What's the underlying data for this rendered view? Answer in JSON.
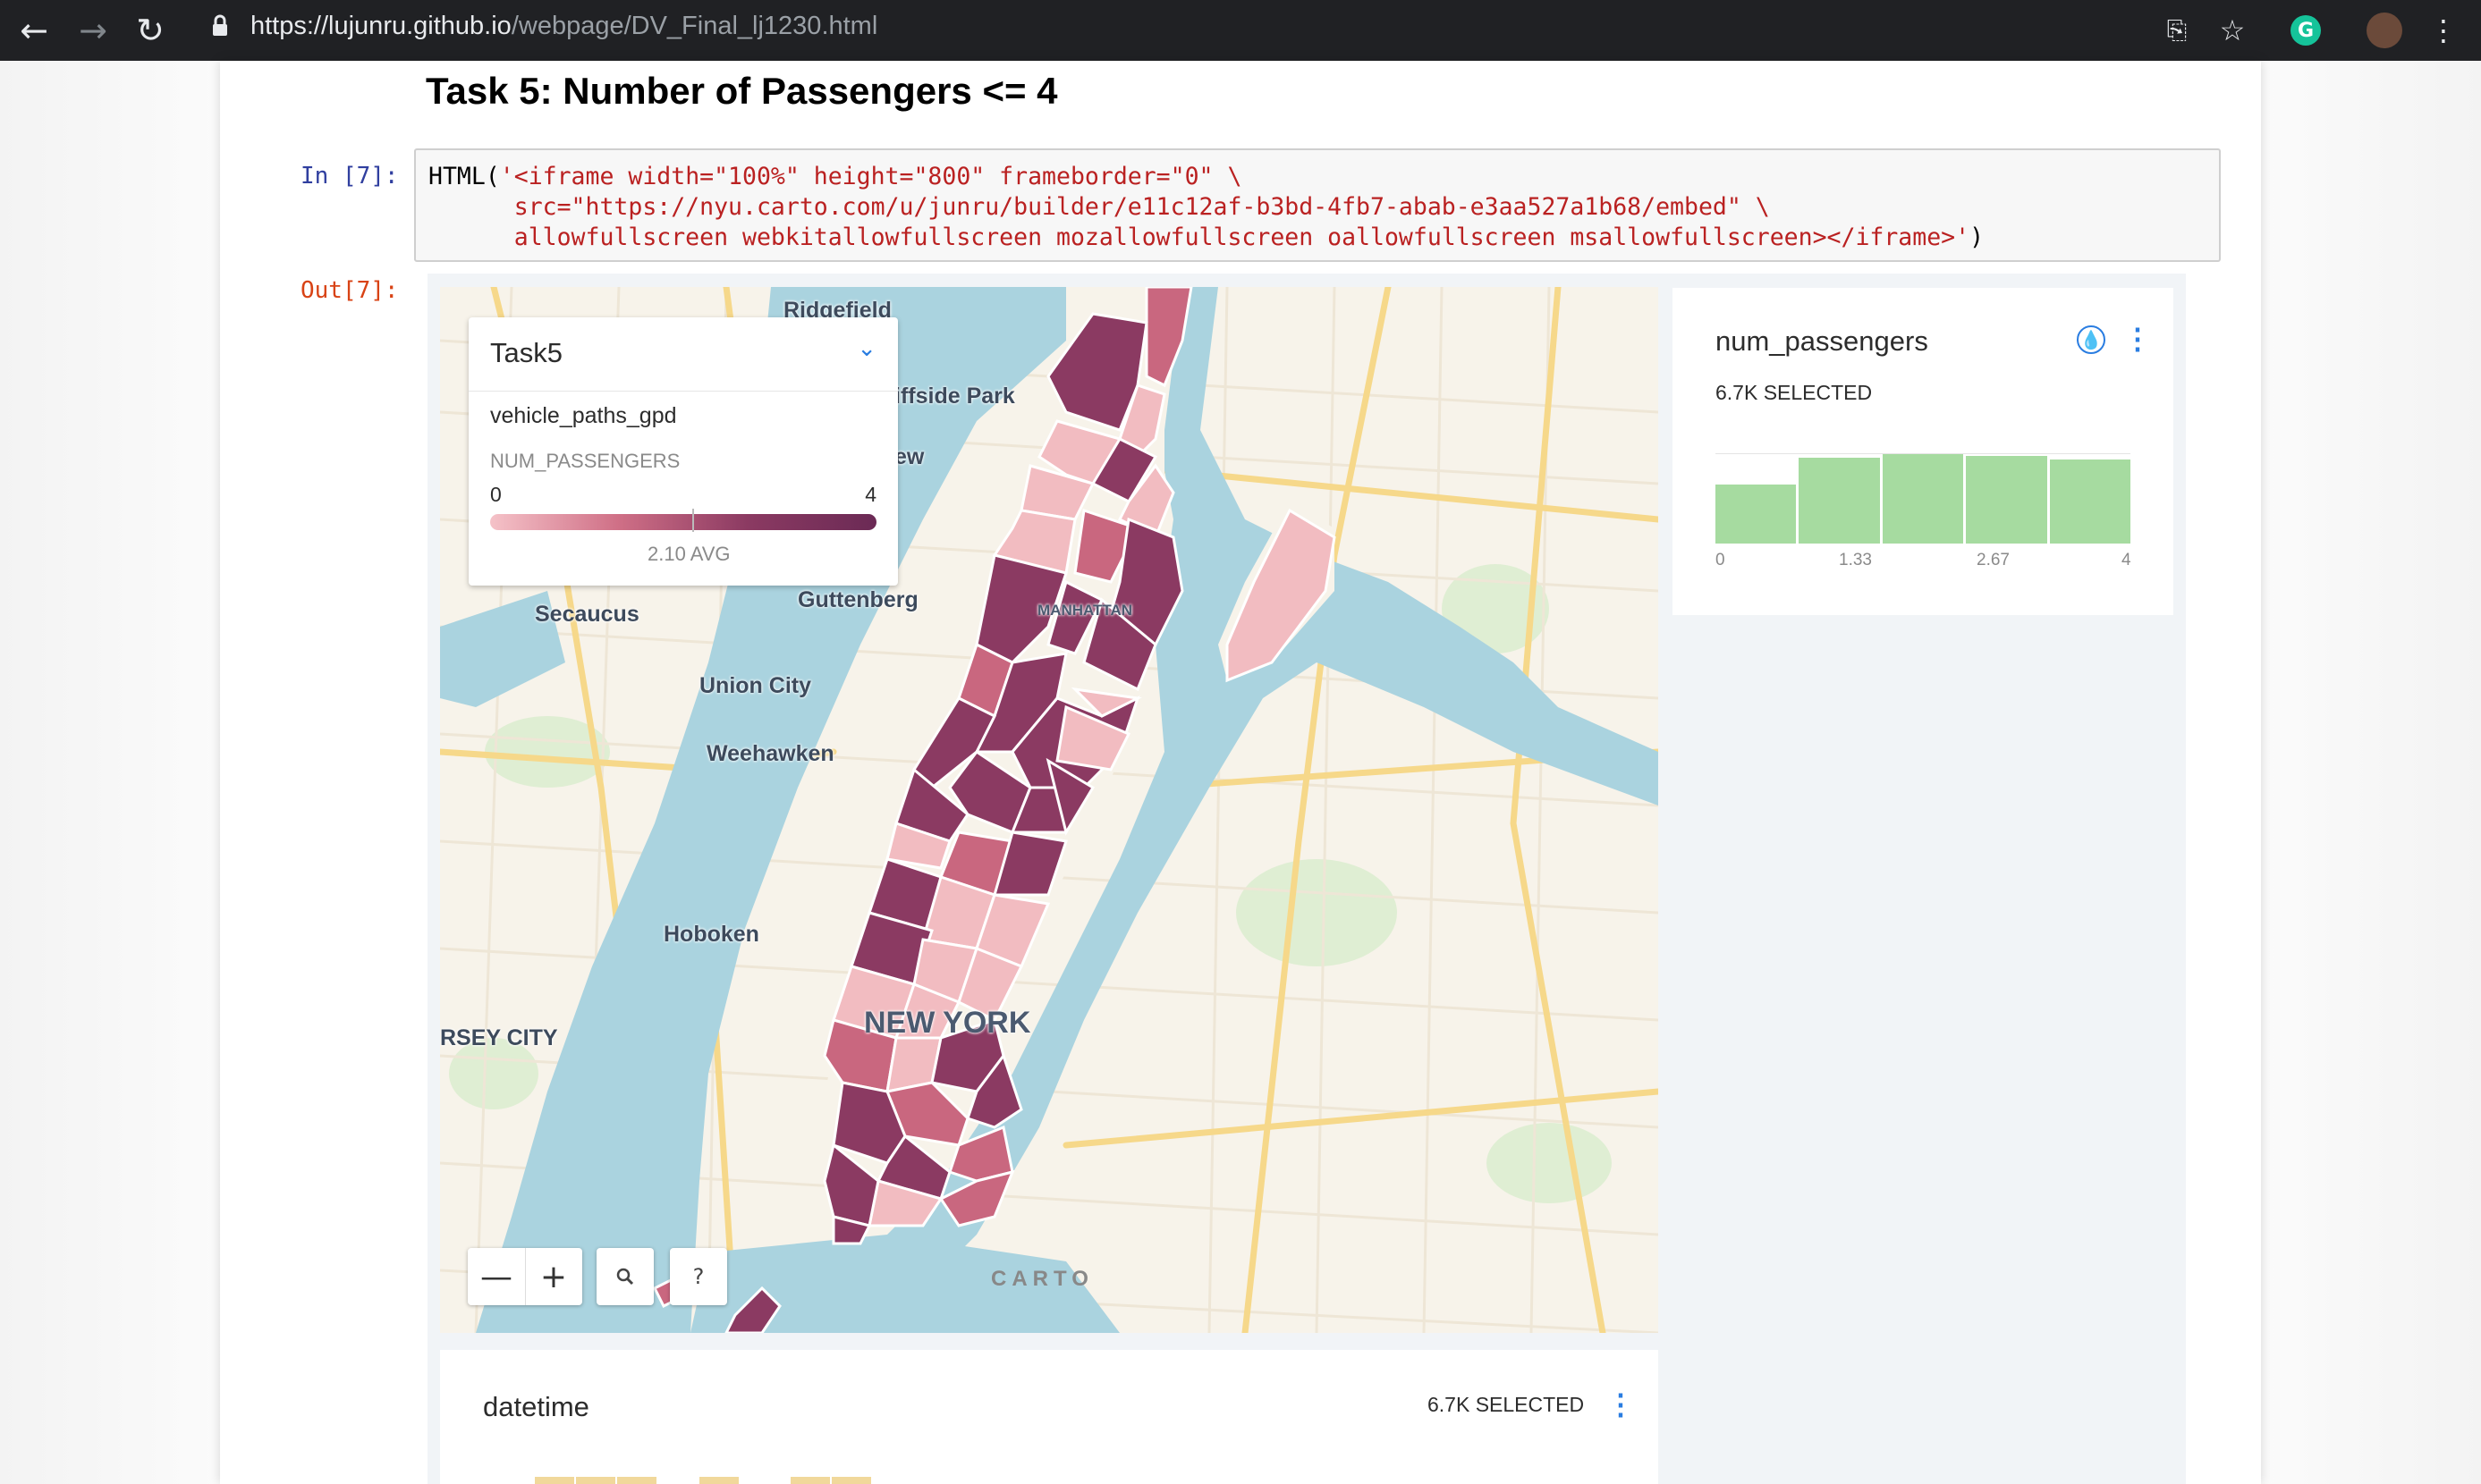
{
  "browser": {
    "url_host": "https://lujunru.github.io",
    "url_path": "/webpage/DV_Final_lj1230.html"
  },
  "notebook": {
    "heading": "Task 5: Number of Passengers <= 4",
    "in_prompt": "In [7]:",
    "out_prompt": "Out[7]:",
    "code_lines": [
      {
        "pre": "HTML(",
        "str": "'<iframe width=\"100%\" height=\"800\" frameborder=\"0\" \\",
        "post": ""
      },
      {
        "pre": "      ",
        "str": "src=\"https://nyu.carto.com/u/junru/builder/e11c12af-b3bd-4fb7-abab-e3aa527a1b68/embed\" \\",
        "post": ""
      },
      {
        "pre": "      ",
        "str": "allowfullscreen webkitallowfullscreen mozallowfullscreen oallowfullscreen msallowfullscreen></iframe>'",
        "post": ")"
      }
    ]
  },
  "map": {
    "labels": {
      "ridgefield": "Ridgefield",
      "cliffside": "iffside Park",
      "fairview": "ew",
      "secaucus": "Secaucus",
      "guttenberg": "Guttenberg",
      "union_city": "Union City",
      "weehawken": "Weehawken",
      "hoboken": "Hoboken",
      "jersey_city": "RSEY CITY",
      "new_york": "NEW YORK",
      "manhattan": "MANHATTAN"
    },
    "attribution": "CARTO",
    "colors": {
      "water": "#aad3df",
      "land": "#f7f3ea",
      "park": "#dfeed3",
      "road": "#f6d88a",
      "class_low": "#f2bcc1",
      "class_mid": "#c9677f",
      "class_high": "#8b3a62"
    }
  },
  "legend": {
    "title": "Task5",
    "layer": "vehicle_paths_gpd",
    "field": "NUM_PASSENGERS",
    "min": "0",
    "max": "4",
    "avg": "2.10 AVG",
    "avg_value": 2.1
  },
  "controls": {
    "zoom_out": "—",
    "zoom_in": "+",
    "search": "🔍",
    "help": "?"
  },
  "widget_passengers": {
    "title": "num_passengers",
    "selected": "6.7K SELECTED",
    "ticks": [
      "0",
      "1.33",
      "2.67",
      "4"
    ],
    "bar_color": "#a6dba0",
    "bins": [
      0.66,
      0.96,
      1.0,
      0.98,
      0.94
    ]
  },
  "widget_datetime": {
    "title": "datetime",
    "selected": "6.7K SELECTED"
  }
}
